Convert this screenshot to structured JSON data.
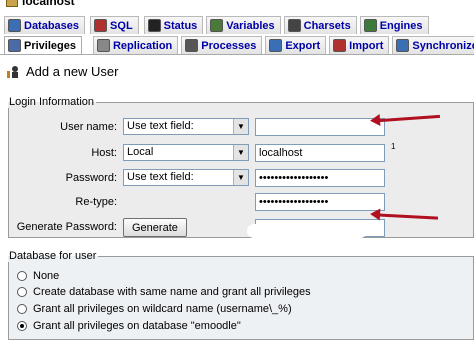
{
  "server": {
    "title": "localhost"
  },
  "tabs_row1": [
    {
      "label": "Databases",
      "icon": "databases-icon",
      "color": "#3a6fb5"
    },
    {
      "label": "SQL",
      "icon": "sql-icon",
      "color": "#b03030"
    },
    {
      "label": "Status",
      "icon": "status-icon",
      "color": "#222222"
    },
    {
      "label": "Variables",
      "icon": "variables-icon",
      "color": "#4a7a3a"
    },
    {
      "label": "Charsets",
      "icon": "charsets-icon",
      "color": "#444444"
    },
    {
      "label": "Engines",
      "icon": "engines-icon",
      "color": "#3a7a3a"
    }
  ],
  "tabs_row2": [
    {
      "label": "Privileges",
      "icon": "privileges-icon",
      "color": "#4a6aa8",
      "active": true
    },
    {
      "label": "Replication",
      "icon": "replication-icon",
      "color": "#888888"
    },
    {
      "label": "Processes",
      "icon": "processes-icon",
      "color": "#555555"
    },
    {
      "label": "Export",
      "icon": "export-icon",
      "color": "#3a6fb5"
    },
    {
      "label": "Import",
      "icon": "import-icon",
      "color": "#b03030"
    },
    {
      "label": "Synchronize",
      "icon": "synchronize-icon",
      "color": "#3a6fb5"
    }
  ],
  "page": {
    "heading": "Add a new User"
  },
  "login": {
    "legend": "Login Information",
    "username_label": "User name:",
    "username_mode": "Use text field:",
    "username_value": "",
    "host_label": "Host:",
    "host_mode": "Local",
    "host_value": "localhost",
    "host_footnote": "1",
    "password_label": "Password:",
    "password_mode": "Use text field:",
    "password_value": "••••••••••••••••••",
    "retype_label": "Re-type:",
    "retype_value": "••••••••••••••••••",
    "generate_label": "Generate Password:",
    "generate_button": "Generate"
  },
  "database": {
    "legend": "Database for user",
    "options": [
      {
        "label": "None",
        "selected": false
      },
      {
        "label": "Create database with same name and grant all privileges",
        "selected": false
      },
      {
        "label": "Grant all privileges on wildcard name (username\\_%)",
        "selected": false
      },
      {
        "label": "Grant all privileges on database \"emoodle\"",
        "selected": true
      }
    ]
  },
  "annotation": {
    "arrow_color": "#b01020"
  }
}
